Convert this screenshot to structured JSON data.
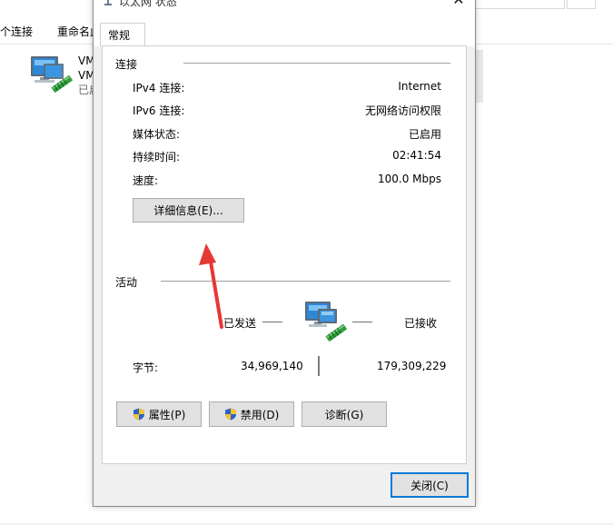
{
  "background_window": {
    "toolbar_items": [
      "个连接",
      "重命名此"
    ],
    "adapter": {
      "name_line1": "VM",
      "name_line2": "VM",
      "status": "已启"
    }
  },
  "dialog": {
    "title": "以太网 状态",
    "close_glyph": "✕",
    "tab_general": "常规",
    "connection": {
      "title": "连接",
      "rows": [
        {
          "label": "IPv4 连接:",
          "value": "Internet"
        },
        {
          "label": "IPv6 连接:",
          "value": "无网络访问权限"
        },
        {
          "label": "媒体状态:",
          "value": "已启用"
        },
        {
          "label": "持续时间:",
          "value": "02:41:54"
        },
        {
          "label": "速度:",
          "value": "100.0 Mbps"
        }
      ],
      "details_button": "详细信息(E)..."
    },
    "activity": {
      "title": "活动",
      "sent_label": "已发送",
      "received_label": "已接收",
      "bytes_label": "字节:",
      "bytes_sent": "34,969,140",
      "bytes_received": "179,309,229"
    },
    "buttons": {
      "properties": "属性(P)",
      "disable": "禁用(D)",
      "diagnose": "诊断(G)",
      "close": "关闭(C)"
    }
  },
  "annotation": {
    "arrow_color": "#e53935"
  },
  "icons": {
    "title": "network-adapter-icon",
    "activity": "network-computer-icon",
    "shield": "uac-shield-icon"
  }
}
